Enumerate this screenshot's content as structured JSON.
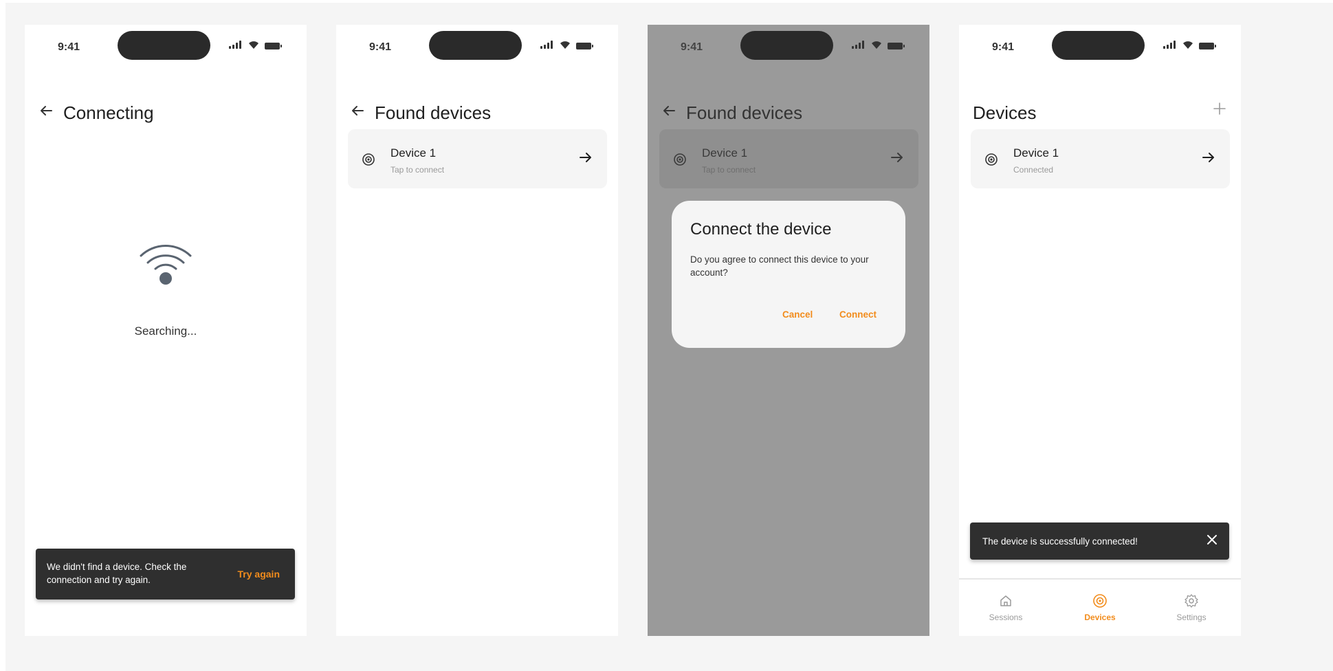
{
  "status_bar": {
    "time": "9:41"
  },
  "screen1": {
    "title": "Connecting",
    "searching": "Searching...",
    "snackbar": {
      "text": "We didn't find a device. Check the connection and try again.",
      "action": "Try again"
    }
  },
  "screen2": {
    "title": "Found devices",
    "device": {
      "name": "Device 1",
      "subtitle": "Tap to connect"
    }
  },
  "screen3": {
    "title": "Found devices",
    "device": {
      "name": "Device 1",
      "subtitle": "Tap to connect"
    },
    "dialog": {
      "title": "Connect the device",
      "body": "Do you agree to connect this device to your account?",
      "cancel": "Cancel",
      "connect": "Connect"
    }
  },
  "screen4": {
    "title": "Devices",
    "device": {
      "name": "Device 1",
      "subtitle": "Connected"
    },
    "snackbar": {
      "text": "The device is successfully connected!"
    },
    "nav": {
      "sessions": "Sessions",
      "devices": "Devices",
      "settings": "Settings",
      "active": "Devices"
    }
  },
  "colors": {
    "accent": "#f28c1c",
    "snackbar": "#2f2f2f",
    "card": "#f5f5f5",
    "scrim": "#9a9a9a",
    "icon": "#5a6470"
  },
  "icons": [
    "back-arrow-icon",
    "forward-arrow-icon",
    "device-icon",
    "wifi-icon",
    "plus-icon",
    "close-icon",
    "home-icon",
    "settings-gear-icon",
    "signal-icon",
    "battery-icon"
  ]
}
